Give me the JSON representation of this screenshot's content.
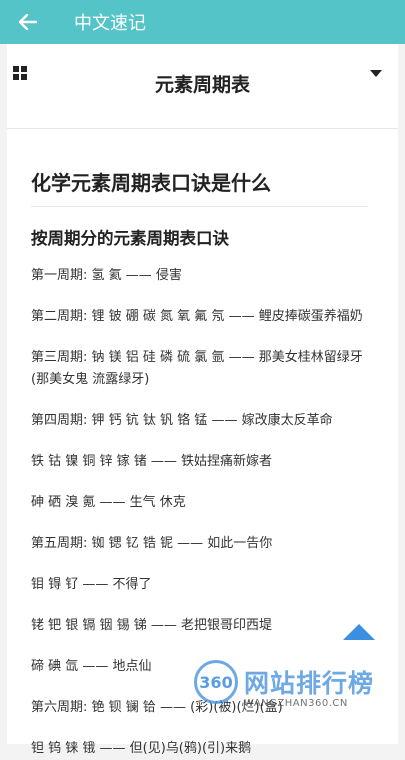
{
  "appbar": {
    "title": "中文速记"
  },
  "topic": {
    "title": "元素周期表"
  },
  "article": {
    "title": "化学元素周期表口诀是什么",
    "section_title": "按周期分的元素周期表口诀",
    "lines": [
      "第一周期: 氢 氦 —— 侵害",
      "第二周期: 锂 铍 硼 碳 氮 氧 氟 氖 —— 鲤皮捧碳蛋养福奶",
      "第三周期: 钠 镁 铝 硅 磷 硫 氯 氩 —— 那美女桂林留绿牙(那美女鬼 流露绿牙)",
      "第四周期: 钾 钙 钪 钛 钒 铬 锰 —— 嫁改康太反革命",
      "铁 钴 镍 铜 锌 镓 锗 —— 铁姑捏痛新嫁者",
      "砷 硒 溴 氪 —— 生气 休克",
      "第五周期: 铷 锶 钇 锆 铌 —— 如此一告你",
      "钼 锝 钌 —— 不得了",
      "铑 钯 银 镉 铟 锡 锑 —— 老把银哥印西堤",
      "碲 碘 氙 —— 地点仙",
      "第六周期: 铯 钡 镧 铪 —— (彩)(被)(烂)(盒)",
      "钽 钨 铼 锇 —— 但(见)乌(鸦)(引)来鹅"
    ]
  },
  "watermark": {
    "logo": "360",
    "text": "网站排行榜",
    "domain": "WANGZHAN360.CN"
  }
}
